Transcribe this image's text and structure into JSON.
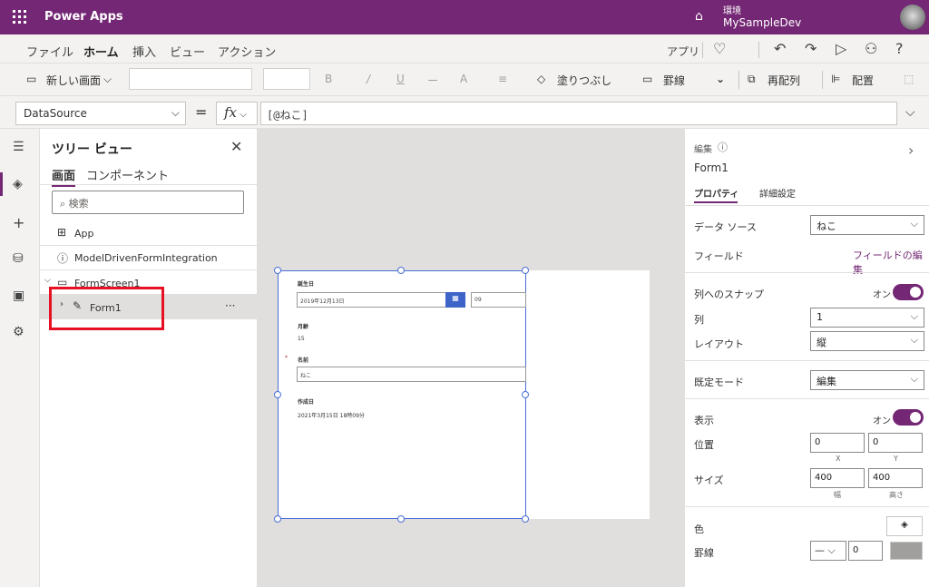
{
  "app": {
    "brand": "Power Apps",
    "env_label": "環境",
    "env_name": "MySampleDev"
  },
  "menu": {
    "items": [
      "ファイル",
      "ホーム",
      "挿入",
      "ビュー",
      "アクション"
    ],
    "apps": "アプリ",
    "help": "?"
  },
  "ribbon": {
    "new_screen": "新しい画面",
    "fill": "塗りつぶし",
    "border": "罫線",
    "reorder": "再配列",
    "align": "配置",
    "bold": "B",
    "italic": "/",
    "underline": "U",
    "strike": "ー",
    "fontsize": "A"
  },
  "formula": {
    "property": "DataSource",
    "eq": "=",
    "fx": "fx",
    "value": "[@ねこ]"
  },
  "tree": {
    "title": "ツリー ビュー",
    "tabs": [
      "画面",
      "コンポーネント"
    ],
    "search_placeholder": "検索",
    "items": [
      "App",
      "ModelDrivenFormIntegration",
      "FormScreen1",
      "Form1"
    ],
    "more": "···"
  },
  "form": {
    "birthday_label": "誕生日",
    "birthday_value": "2019年12月13日",
    "hour_value": "09",
    "age_label": "月齢",
    "age_value": "15",
    "name_label": "名前",
    "name_value": "ねこ",
    "required_mark": "*",
    "created_label": "作成日",
    "created_value": "2021年3月15日 18時09分"
  },
  "props": {
    "kind": "編集",
    "name": "Form1",
    "tabs": [
      "プロパティ",
      "詳細設定"
    ],
    "datasource_label": "データ ソース",
    "datasource_value": "ねこ",
    "fields_label": "フィールド",
    "fields_link": "フィールドの編集",
    "snap_label": "列へのスナップ",
    "snap_state": "オン",
    "columns_label": "列",
    "columns_value": "1",
    "layout_label": "レイアウト",
    "layout_value": "縦",
    "mode_label": "既定モード",
    "mode_value": "編集",
    "visible_label": "表示",
    "visible_state": "オン",
    "position_label": "位置",
    "pos_x": "0",
    "pos_y": "0",
    "x_label": "X",
    "y_label": "Y",
    "size_label": "サイズ",
    "width": "400",
    "height": "400",
    "width_label": "幅",
    "height_label": "高さ",
    "color_label": "色",
    "border_label": "罫線",
    "border_width": "0"
  }
}
